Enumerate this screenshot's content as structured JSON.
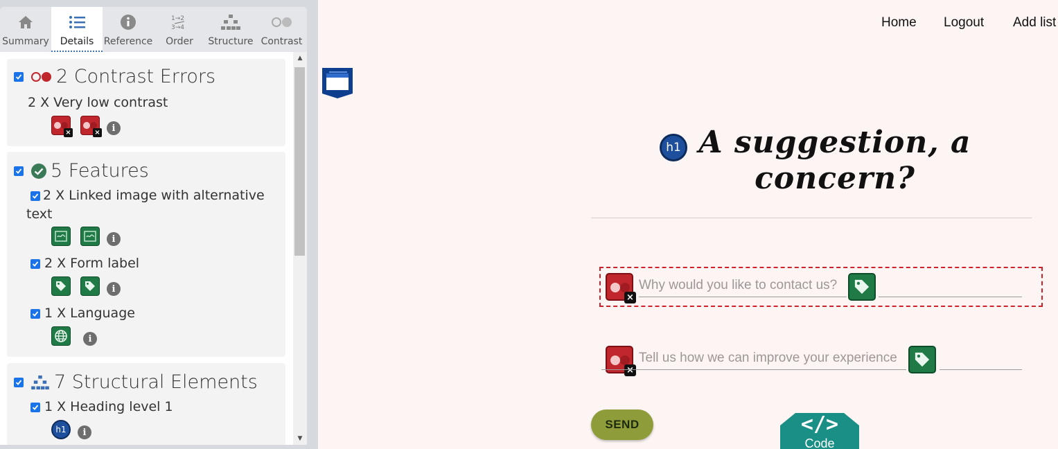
{
  "panel": {
    "tabs": [
      {
        "label": "Summary",
        "icon": "home-icon"
      },
      {
        "label": "Details",
        "icon": "list-icon",
        "active": true
      },
      {
        "label": "Reference",
        "icon": "info-icon"
      },
      {
        "label": "Order",
        "icon": "order-icon"
      },
      {
        "label": "Structure",
        "icon": "structure-icon"
      },
      {
        "label": "Contrast",
        "icon": "contrast-icon"
      }
    ],
    "contrast": {
      "heading": "2 Contrast Errors",
      "items": [
        {
          "label": "2 X Very low contrast",
          "count": 2
        }
      ]
    },
    "features": {
      "heading": "5 Features",
      "items": [
        {
          "label": "2 X Linked image with alternative text",
          "count": 2
        },
        {
          "label": "2 X Form label",
          "count": 2
        },
        {
          "label": "1 X Language",
          "count": 1
        }
      ]
    },
    "structure": {
      "heading": "7 Structural Elements",
      "items": [
        {
          "label": "1 X Heading level 1",
          "count": 1,
          "badge": "h1"
        }
      ]
    }
  },
  "nav": {
    "home": "Home",
    "logout": "Logout",
    "add_list": "Add list"
  },
  "page": {
    "h1_badge": "h1",
    "heading": "A suggestion, a concern?",
    "field1_placeholder": "Why would you like to contact us?",
    "field2_placeholder": "Tell us how we can improve your experience",
    "send": "SEND",
    "code": "Code",
    "code_glyph": "</>"
  },
  "colors": {
    "error": "#c0272d",
    "feature": "#1f7a46",
    "send": "#8e9d3a",
    "code": "#1a8f86",
    "page_bg": "#fdf5f3"
  }
}
